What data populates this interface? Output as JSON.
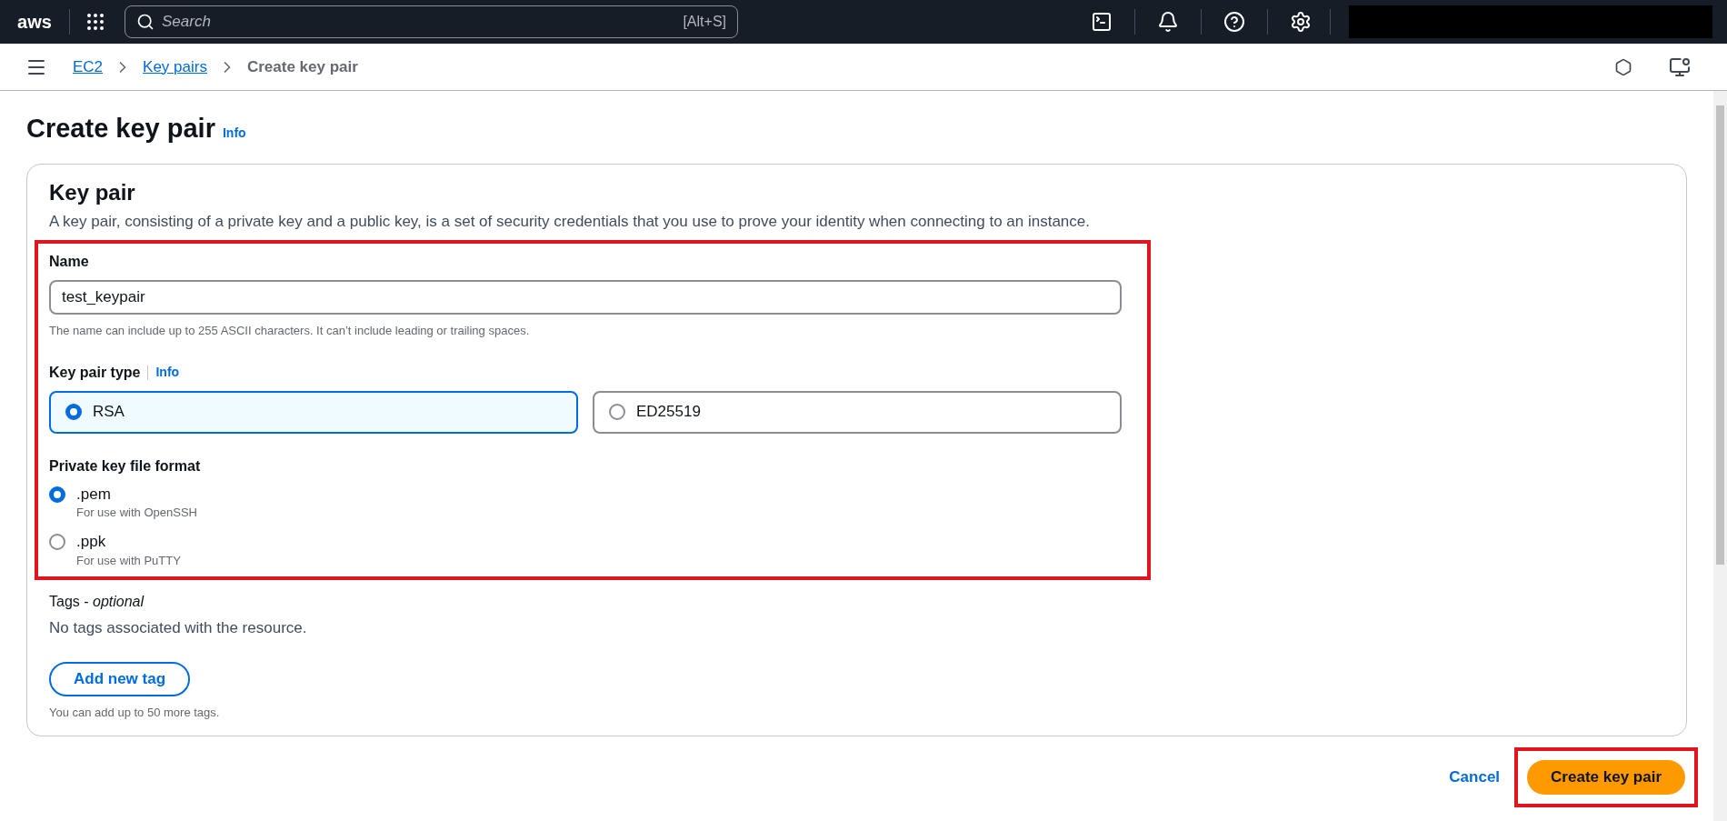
{
  "top_nav": {
    "logo": "aws",
    "search": {
      "placeholder": "Search",
      "shortcut": "[Alt+S]"
    }
  },
  "breadcrumbs": [
    {
      "label": "EC2",
      "link": true
    },
    {
      "label": "Key pairs",
      "link": true
    },
    {
      "label": "Create key pair",
      "link": false
    }
  ],
  "page": {
    "title": "Create key pair",
    "info": "Info"
  },
  "card": {
    "title": "Key pair",
    "description": "A key pair, consisting of a private key and a public key, is a set of security credentials that you use to prove your identity when connecting to an instance.",
    "name_field": {
      "label": "Name",
      "value": "test_keypair",
      "hint": "The name can include up to 255 ASCII characters. It can’t include leading or trailing spaces."
    },
    "key_pair_type": {
      "label": "Key pair type",
      "info": "Info",
      "options": [
        {
          "label": "RSA",
          "selected": true
        },
        {
          "label": "ED25519",
          "selected": false
        }
      ]
    },
    "file_format": {
      "label": "Private key file format",
      "options": [
        {
          "label": ".pem",
          "description": "For use with OpenSSH",
          "selected": true
        },
        {
          "label": ".ppk",
          "description": "For use with PuTTY",
          "selected": false
        }
      ]
    },
    "tags": {
      "label": "Tags - *optional*",
      "empty": "No tags associated with the resource.",
      "add_button": "Add new tag",
      "hint": "You can add up to 50 more tags."
    }
  },
  "actions": {
    "cancel": "Cancel",
    "submit": "Create key pair"
  }
}
